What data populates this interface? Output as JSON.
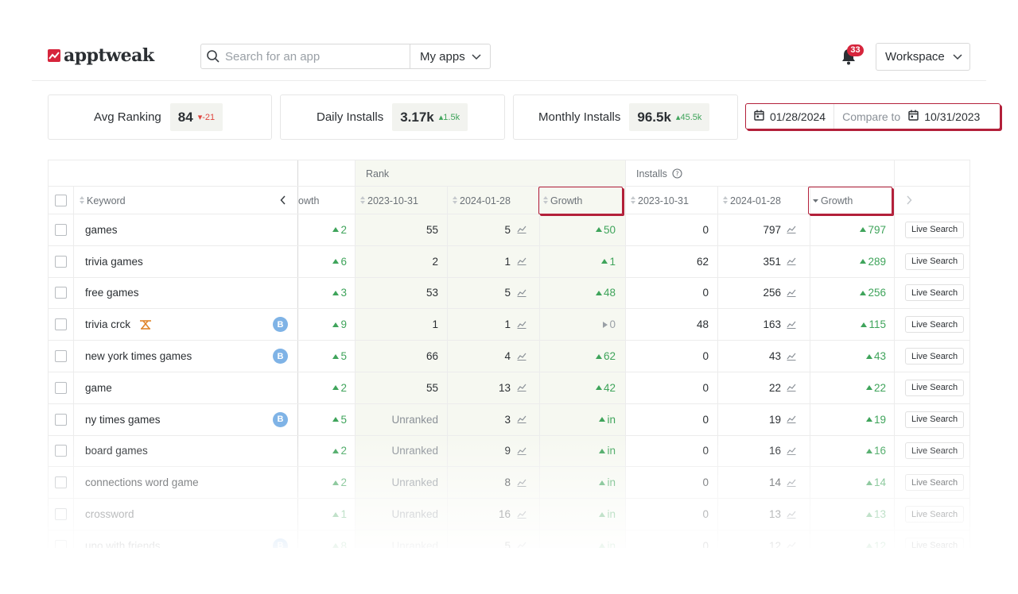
{
  "header": {
    "logo_text": "apptweak",
    "search_placeholder": "Search for an app",
    "my_apps_label": "My apps",
    "notifications_count": "33",
    "workspace_label": "Workspace"
  },
  "kpis": [
    {
      "label": "Avg Ranking",
      "value": "84",
      "delta": "21",
      "direction": "down"
    },
    {
      "label": "Daily Installs",
      "value": "3.17k",
      "delta": "1.5k",
      "direction": "up"
    },
    {
      "label": "Monthly Installs",
      "value": "96.5k",
      "delta": "45.5k",
      "direction": "up"
    }
  ],
  "date_range": {
    "date": "01/28/2024",
    "compare_label": "Compare to",
    "compare_date": "10/31/2023"
  },
  "table": {
    "groups": {
      "rank": "Rank",
      "installs": "Installs"
    },
    "columns": {
      "keyword": "Keyword",
      "growth_partial": "owth",
      "rank_prev": "2023-10-31",
      "rank_curr": "2024-01-28",
      "rank_growth": "Growth",
      "inst_prev": "2023-10-31",
      "inst_curr": "2024-01-28",
      "inst_growth": "Growth"
    },
    "live_search_label": "Live Search",
    "rows": [
      {
        "keyword": "games",
        "badge": "",
        "icon": "",
        "prev_growth": "2",
        "rank_prev": "55",
        "rank_curr": "5",
        "rank_growth": "50",
        "rank_growth_dir": "up",
        "inst_prev": "0",
        "inst_curr": "797",
        "inst_growth": "797"
      },
      {
        "keyword": "trivia games",
        "badge": "",
        "icon": "",
        "prev_growth": "6",
        "rank_prev": "2",
        "rank_curr": "1",
        "rank_growth": "1",
        "rank_growth_dir": "up",
        "inst_prev": "62",
        "inst_curr": "351",
        "inst_growth": "289"
      },
      {
        "keyword": "free games",
        "badge": "",
        "icon": "",
        "prev_growth": "3",
        "rank_prev": "53",
        "rank_curr": "5",
        "rank_growth": "48",
        "rank_growth_dir": "up",
        "inst_prev": "0",
        "inst_curr": "256",
        "inst_growth": "256"
      },
      {
        "keyword": "trivia crck",
        "badge": "B",
        "icon": "tool-icon",
        "prev_growth": "9",
        "rank_prev": "1",
        "rank_curr": "1",
        "rank_growth": "0",
        "rank_growth_dir": "flat",
        "inst_prev": "48",
        "inst_curr": "163",
        "inst_growth": "115"
      },
      {
        "keyword": "new york times games",
        "badge": "B",
        "icon": "",
        "prev_growth": "5",
        "rank_prev": "66",
        "rank_curr": "4",
        "rank_growth": "62",
        "rank_growth_dir": "up",
        "inst_prev": "0",
        "inst_curr": "43",
        "inst_growth": "43"
      },
      {
        "keyword": "game",
        "badge": "",
        "icon": "",
        "prev_growth": "2",
        "rank_prev": "55",
        "rank_curr": "13",
        "rank_growth": "42",
        "rank_growth_dir": "up",
        "inst_prev": "0",
        "inst_curr": "22",
        "inst_growth": "22"
      },
      {
        "keyword": "ny times games",
        "badge": "B",
        "icon": "",
        "prev_growth": "5",
        "rank_prev": "Unranked",
        "rank_curr": "3",
        "rank_growth": "in",
        "rank_growth_dir": "up",
        "inst_prev": "0",
        "inst_curr": "19",
        "inst_growth": "19"
      },
      {
        "keyword": "board games",
        "badge": "",
        "icon": "",
        "prev_growth": "2",
        "rank_prev": "Unranked",
        "rank_curr": "9",
        "rank_growth": "in",
        "rank_growth_dir": "up",
        "inst_prev": "0",
        "inst_curr": "16",
        "inst_growth": "16"
      },
      {
        "keyword": "connections word game",
        "badge": "",
        "icon": "",
        "prev_growth": "2",
        "rank_prev": "Unranked",
        "rank_curr": "8",
        "rank_growth": "in",
        "rank_growth_dir": "up",
        "inst_prev": "0",
        "inst_curr": "14",
        "inst_growth": "14"
      },
      {
        "keyword": "crossword",
        "badge": "",
        "icon": "",
        "prev_growth": "1",
        "rank_prev": "Unranked",
        "rank_curr": "16",
        "rank_growth": "in",
        "rank_growth_dir": "up",
        "inst_prev": "0",
        "inst_curr": "13",
        "inst_growth": "13"
      },
      {
        "keyword": "uno with friends",
        "badge": "B",
        "icon": "",
        "prev_growth": "8",
        "rank_prev": "Unranked",
        "rank_curr": "5",
        "rank_growth": "in",
        "rank_growth_dir": "up",
        "inst_prev": "0",
        "inst_curr": "12",
        "inst_growth": "12"
      }
    ]
  },
  "colors": {
    "brand": "#d6253c",
    "growth_up": "#3fa45b",
    "growth_down": "#e0453e",
    "highlight": "#b3203a",
    "rank_band": "#f6f8f1"
  }
}
